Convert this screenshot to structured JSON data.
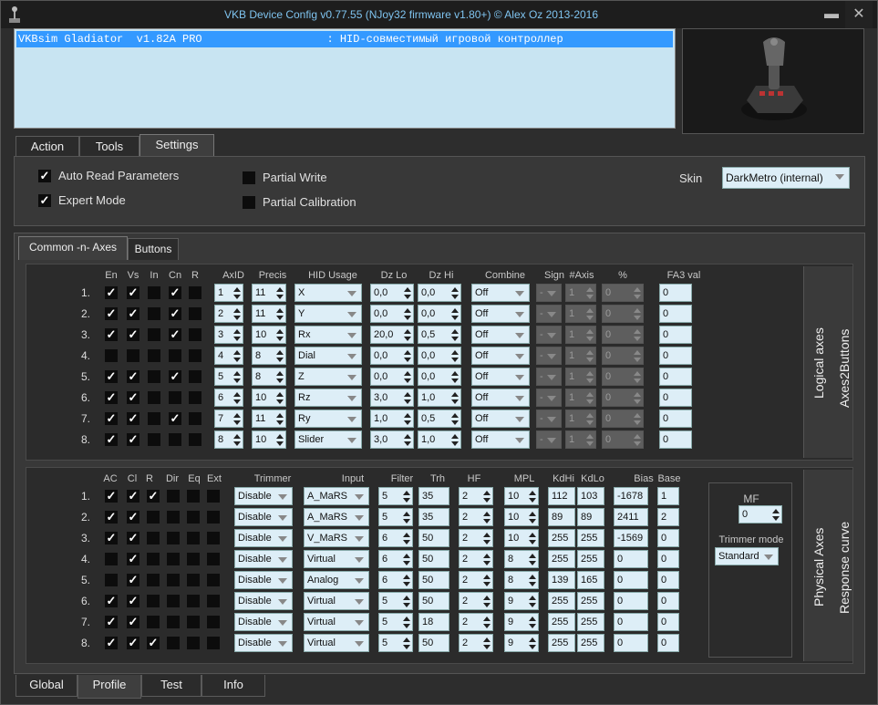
{
  "window": {
    "title": "VKB Device Config v0.77.55 (NJoy32 firmware v1.80+) © Alex Oz 2013-2016",
    "min": "▬",
    "close": "✕"
  },
  "device": {
    "row": "VKBsim Gladiator  v1.82A PRO                   : HID-совместимый игровой контроллер"
  },
  "top_tabs": [
    "Action",
    "Tools",
    "Settings"
  ],
  "settings": {
    "auto_read": {
      "label": "Auto Read Parameters",
      "checked": true
    },
    "expert": {
      "label": "Expert Mode",
      "checked": true
    },
    "partial_write": {
      "label": "Partial Write",
      "checked": false
    },
    "partial_cal": {
      "label": "Partial Calibration",
      "checked": false
    },
    "skin_label": "Skin",
    "skin_value": "DarkMetro (internal)"
  },
  "sub_tabs": [
    "Common -n- Axes",
    "Buttons"
  ],
  "logical": {
    "headers": [
      "En",
      "Vs",
      "In",
      "Cn",
      "R",
      "AxID",
      "Precis",
      "HID Usage",
      "Dz Lo",
      "Dz Hi",
      "Combine",
      "Sign",
      "#Axis",
      "%",
      "FA3 val"
    ],
    "rows": [
      {
        "n": "1.",
        "chk": [
          1,
          1,
          0,
          1,
          0
        ],
        "axid": "1",
        "precis": "11",
        "hid": "X",
        "dzlo": "0,0",
        "dzhi": "0,0",
        "combine": "Off",
        "sign": "-",
        "naxis": "1",
        "pct": "0",
        "fa3": "0"
      },
      {
        "n": "2.",
        "chk": [
          1,
          1,
          0,
          1,
          0
        ],
        "axid": "2",
        "precis": "11",
        "hid": "Y",
        "dzlo": "0,0",
        "dzhi": "0,0",
        "combine": "Off",
        "sign": "-",
        "naxis": "1",
        "pct": "0",
        "fa3": "0"
      },
      {
        "n": "3.",
        "chk": [
          1,
          1,
          0,
          1,
          0
        ],
        "axid": "3",
        "precis": "10",
        "hid": "Rx",
        "dzlo": "20,0",
        "dzhi": "0,5",
        "combine": "Off",
        "sign": "-",
        "naxis": "1",
        "pct": "0",
        "fa3": "0"
      },
      {
        "n": "4.",
        "chk": [
          0,
          0,
          0,
          0,
          0
        ],
        "axid": "4",
        "precis": "8",
        "hid": "Dial",
        "dzlo": "0,0",
        "dzhi": "0,0",
        "combine": "Off",
        "sign": "-",
        "naxis": "1",
        "pct": "0",
        "fa3": "0"
      },
      {
        "n": "5.",
        "chk": [
          1,
          1,
          0,
          1,
          0
        ],
        "axid": "5",
        "precis": "8",
        "hid": "Z",
        "dzlo": "0,0",
        "dzhi": "0,0",
        "combine": "Off",
        "sign": "-",
        "naxis": "1",
        "pct": "0",
        "fa3": "0"
      },
      {
        "n": "6.",
        "chk": [
          1,
          1,
          0,
          0,
          0
        ],
        "axid": "6",
        "precis": "10",
        "hid": "Rz",
        "dzlo": "3,0",
        "dzhi": "1,0",
        "combine": "Off",
        "sign": "-",
        "naxis": "1",
        "pct": "0",
        "fa3": "0"
      },
      {
        "n": "7.",
        "chk": [
          1,
          1,
          0,
          1,
          0
        ],
        "axid": "7",
        "precis": "11",
        "hid": "Ry",
        "dzlo": "1,0",
        "dzhi": "0,5",
        "combine": "Off",
        "sign": "-",
        "naxis": "1",
        "pct": "0",
        "fa3": "0"
      },
      {
        "n": "8.",
        "chk": [
          1,
          1,
          0,
          0,
          0
        ],
        "axid": "8",
        "precis": "10",
        "hid": "Slider",
        "dzlo": "3,0",
        "dzhi": "1,0",
        "combine": "Off",
        "sign": "-",
        "naxis": "1",
        "pct": "0",
        "fa3": "0"
      }
    ],
    "vtab1": "Logical axes",
    "vtab2": "Axes2Buttons"
  },
  "physical": {
    "headers": [
      "AC",
      "Cl",
      "R",
      "Dir",
      "Eq",
      "Ext",
      "Trimmer",
      "Input",
      "Filter",
      "Trh",
      "HF",
      "MPL",
      "KdHi",
      "KdLo",
      "Bias",
      "Base"
    ],
    "rows": [
      {
        "n": "1.",
        "chk": [
          1,
          1,
          1,
          0,
          0,
          0
        ],
        "trimmer": "Disable",
        "input": "A_MaRS",
        "filter": "5",
        "trh": "35",
        "hf": "2",
        "mpl": "10",
        "kdhi": "112",
        "kdlo": "103",
        "bias": "-1678",
        "base": "1"
      },
      {
        "n": "2.",
        "chk": [
          1,
          1,
          0,
          0,
          0,
          0
        ],
        "trimmer": "Disable",
        "input": "A_MaRS",
        "filter": "5",
        "trh": "35",
        "hf": "2",
        "mpl": "10",
        "kdhi": "89",
        "kdlo": "89",
        "bias": "2411",
        "base": "2"
      },
      {
        "n": "3.",
        "chk": [
          1,
          1,
          0,
          0,
          0,
          0
        ],
        "trimmer": "Disable",
        "input": "V_MaRS",
        "filter": "6",
        "trh": "50",
        "hf": "2",
        "mpl": "10",
        "kdhi": "255",
        "kdlo": "255",
        "bias": "-1569",
        "base": "0"
      },
      {
        "n": "4.",
        "chk": [
          0,
          1,
          0,
          0,
          0,
          0
        ],
        "trimmer": "Disable",
        "input": "Virtual",
        "filter": "6",
        "trh": "50",
        "hf": "2",
        "mpl": "8",
        "kdhi": "255",
        "kdlo": "255",
        "bias": "0",
        "base": "0"
      },
      {
        "n": "5.",
        "chk": [
          0,
          1,
          0,
          0,
          0,
          0
        ],
        "trimmer": "Disable",
        "input": "Analog",
        "filter": "6",
        "trh": "50",
        "hf": "2",
        "mpl": "8",
        "kdhi": "139",
        "kdlo": "165",
        "bias": "0",
        "base": "0"
      },
      {
        "n": "6.",
        "chk": [
          1,
          1,
          0,
          0,
          0,
          0
        ],
        "trimmer": "Disable",
        "input": "Virtual",
        "filter": "5",
        "trh": "50",
        "hf": "2",
        "mpl": "9",
        "kdhi": "255",
        "kdlo": "255",
        "bias": "0",
        "base": "0"
      },
      {
        "n": "7.",
        "chk": [
          1,
          1,
          0,
          0,
          0,
          0
        ],
        "trimmer": "Disable",
        "input": "Virtual",
        "filter": "5",
        "trh": "18",
        "hf": "2",
        "mpl": "9",
        "kdhi": "255",
        "kdlo": "255",
        "bias": "0",
        "base": "0"
      },
      {
        "n": "8.",
        "chk": [
          1,
          1,
          1,
          0,
          0,
          0
        ],
        "trimmer": "Disable",
        "input": "Virtual",
        "filter": "5",
        "trh": "50",
        "hf": "2",
        "mpl": "9",
        "kdhi": "255",
        "kdlo": "255",
        "bias": "0",
        "base": "0"
      }
    ],
    "mf_label": "MF",
    "mf_value": "0",
    "trimmer_mode_label": "Trimmer mode",
    "trimmer_mode_value": "Standard",
    "vtab1": "Physical Axes",
    "vtab2": "Response curve"
  },
  "bottom_tabs": [
    "Global",
    "Profile",
    "Test",
    "Info"
  ],
  "check_mark": "✓"
}
